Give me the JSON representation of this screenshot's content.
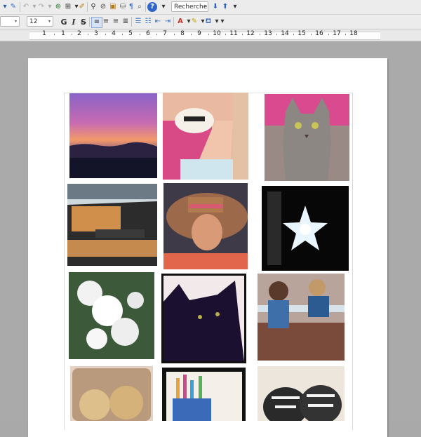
{
  "toolbar": {
    "search_placeholder": "Recherche",
    "font_size": "12",
    "bold": "G",
    "italic": "I",
    "strike": "S"
  },
  "ruler": {
    "numbers": [
      "1",
      "1",
      "2",
      "3",
      "4",
      "5",
      "6",
      "7",
      "8",
      "9",
      "10",
      "11",
      "12",
      "13",
      "14",
      "15",
      "16",
      "17",
      "18"
    ]
  },
  "document": {
    "photos": [
      "sunset-photo",
      "hat-legs-photo",
      "tabby-cat-photo",
      "batman-boat-photo",
      "woman-sunhat-photo",
      "star-lamp-photo",
      "white-flowers-photo",
      "black-cat-photo",
      "kids-table-photo",
      "cookies-photo",
      "pens-cup-photo",
      "sneakers-photo"
    ]
  },
  "colors": {
    "canvas": "#aaaaaa",
    "toolbar": "#ececec",
    "page": "#ffffff"
  }
}
